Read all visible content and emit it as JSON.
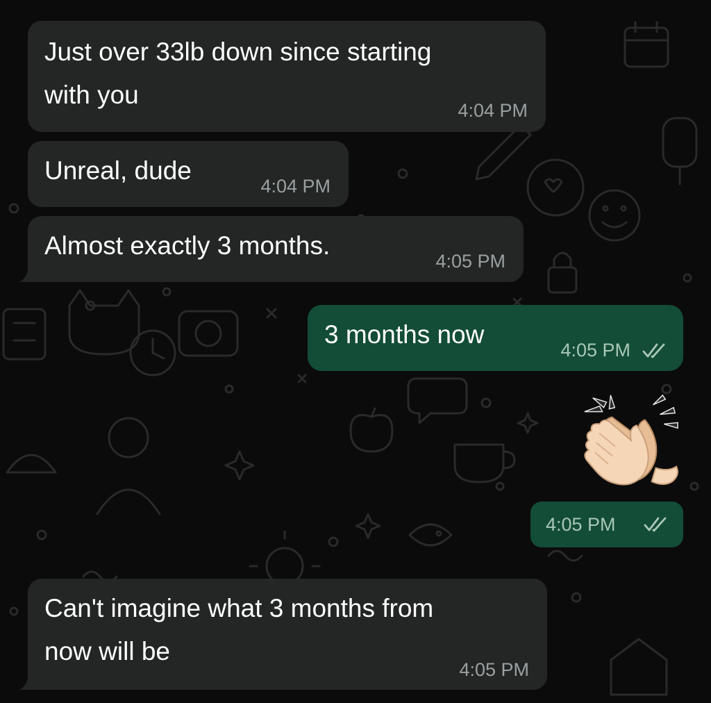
{
  "messages": [
    {
      "direction": "incoming",
      "text_lines": [
        "Just over 33lb down since starting",
        "with you"
      ],
      "time": "4:04 PM"
    },
    {
      "direction": "incoming",
      "text": "Unreal, dude",
      "time": "4:04 PM"
    },
    {
      "direction": "incoming",
      "text": "Almost exactly 3 months.",
      "time": "4:05 PM"
    },
    {
      "direction": "outgoing",
      "text": "3 months now",
      "time": "4:05 PM",
      "status": "read"
    },
    {
      "direction": "outgoing",
      "emoji": "clapping-hands",
      "skin_tone": "light",
      "time": "4:05 PM",
      "status": "read"
    },
    {
      "direction": "incoming",
      "text_lines": [
        "Can't imagine what 3 months from",
        "now will be"
      ],
      "time": "4:05 PM"
    }
  ],
  "colors": {
    "background": "#0b0b0b",
    "incoming_bubble": "#242626",
    "outgoing_bubble": "#134d37",
    "read_ticks": "#a9c7b7"
  }
}
